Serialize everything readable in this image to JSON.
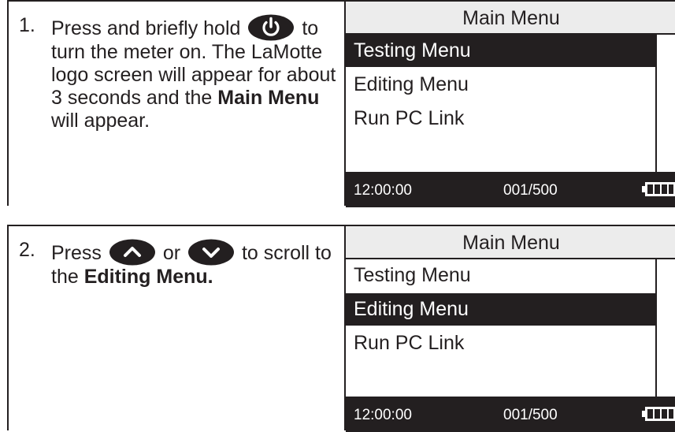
{
  "steps": [
    {
      "number": "1.",
      "text_a": "Press and briefly hold",
      "icon_a": "power-icon",
      "text_b": "to turn the meter on. The LaMotte logo screen will appear for about 3 seconds and the",
      "bold": "Main Menu",
      "text_c": "will appear.",
      "screen": {
        "title": "Main Menu",
        "items": [
          "Testing Menu",
          "Editing Menu",
          "Run PC Link"
        ],
        "selected_index": 0,
        "time": "12:00:00",
        "count": "001/500",
        "battery_icon": "battery-icon"
      }
    },
    {
      "number": "2.",
      "text_a": "Press",
      "icon_a": "up-arrow-icon",
      "text_or": "or",
      "icon_b": "down-arrow-icon",
      "text_b": "to scroll to the",
      "bold": "Editing Menu.",
      "screen": {
        "title": "Main Menu",
        "items": [
          "Testing Menu",
          "Editing Menu",
          "Run PC Link"
        ],
        "selected_index": 1,
        "time": "12:00:00",
        "count": "001/500",
        "battery_icon": "battery-icon"
      }
    }
  ],
  "colors": {
    "ink": "#231f20",
    "title_bar": "#ececec",
    "background": "#ffffff"
  }
}
